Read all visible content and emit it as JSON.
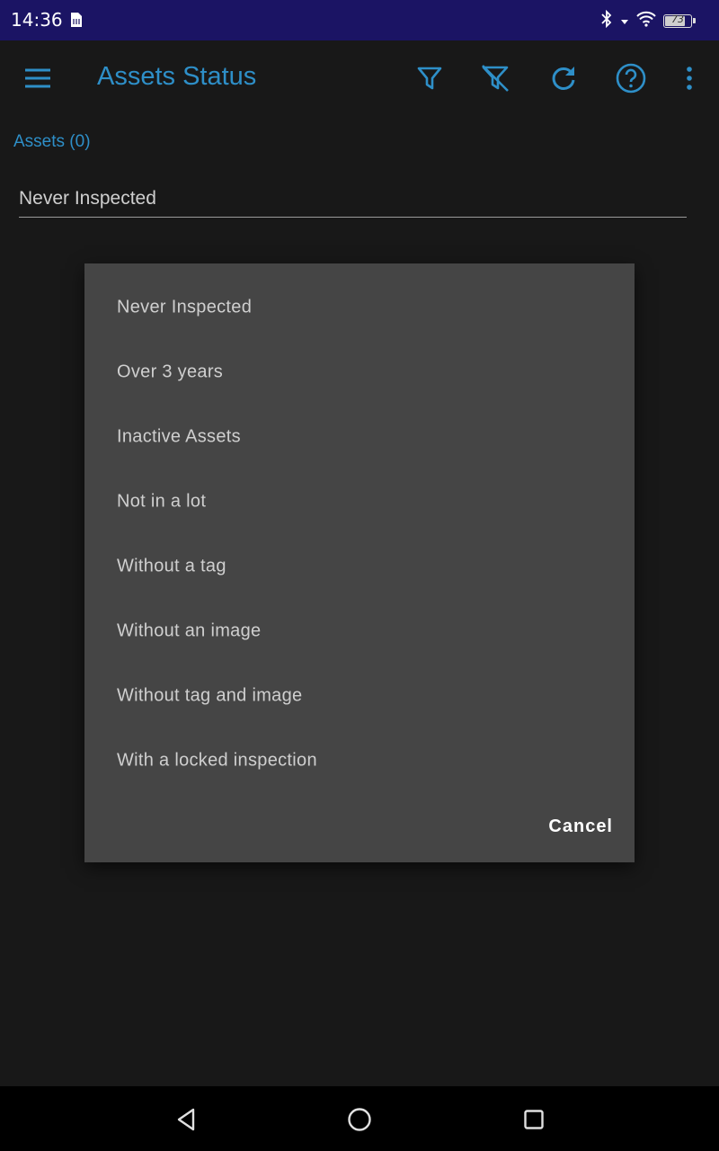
{
  "status_bar": {
    "time": "14:36",
    "battery_level": "73",
    "icons": [
      "sim-card-icon",
      "bluetooth-icon",
      "signal-arrow-icon",
      "wifi-icon",
      "battery-icon"
    ]
  },
  "app_bar": {
    "title": "Assets Status",
    "actions": [
      "filter-icon",
      "clear-filter-icon",
      "refresh-icon",
      "help-icon",
      "more-vert-icon"
    ]
  },
  "assets_label": "Assets (0)",
  "filter_spinner": {
    "selected": "Never Inspected"
  },
  "dialog": {
    "options": [
      "Never Inspected",
      "Over 3 years",
      "Inactive Assets",
      "Not in a lot",
      "Without a tag",
      "Without an image",
      "Without tag and image",
      "With a locked inspection"
    ],
    "cancel_label": "Cancel"
  },
  "nav_bar": {
    "buttons": [
      "back-icon",
      "home-icon",
      "recents-icon"
    ]
  },
  "colors": {
    "status_bar": "#1b1464",
    "accent": "#2e8fc8",
    "background": "#181818",
    "dialog": "#454545"
  }
}
